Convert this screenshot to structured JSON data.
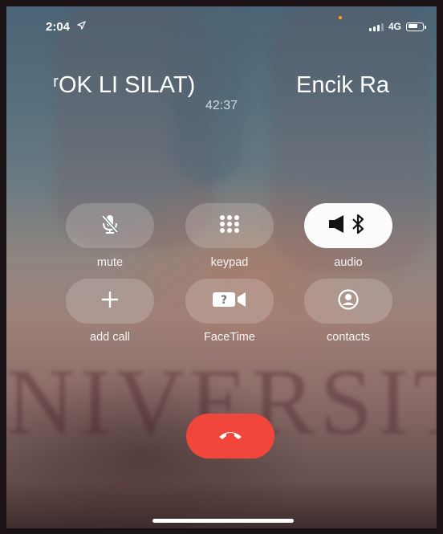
{
  "status_bar": {
    "time": "2:04",
    "location_icon": "location-arrow-icon",
    "network": "4G",
    "signal_bars": 3,
    "signal_bars_total": 4,
    "battery_level": 0.7
  },
  "call": {
    "caller_name_part1": "ʳOK LI SILAT)",
    "caller_name_part2": "Encik Ra",
    "duration": "42:37"
  },
  "controls": [
    {
      "label": "mute",
      "icon": "mic-off-icon"
    },
    {
      "label": "keypad",
      "icon": "keypad-icon"
    },
    {
      "label": "audio",
      "icon": "speaker-bluetooth-icon",
      "active": true
    },
    {
      "label": "add call",
      "icon": "plus-icon"
    },
    {
      "label": "FaceTime",
      "icon": "facetime-icon"
    },
    {
      "label": "contacts",
      "icon": "contact-icon"
    }
  ],
  "end_call": {
    "icon": "end-call-icon",
    "color": "#f0463c"
  },
  "background_text": "NIVERSIT",
  "colors": {
    "end_call": "#f0463c",
    "button_bg": "rgba(255,255,255,0.18)",
    "active_button_bg": "#fbfbfb",
    "status_dot": "#ff9f0a"
  }
}
